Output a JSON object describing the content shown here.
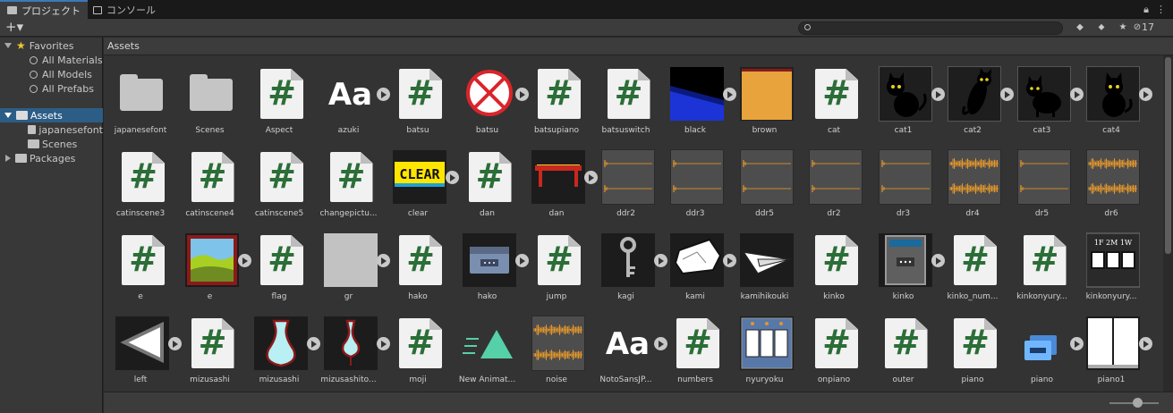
{
  "tabs": [
    {
      "label": "プロジェクト",
      "icon": "folder-icon",
      "active": true
    },
    {
      "label": "コンソール",
      "icon": "console-icon",
      "active": false
    }
  ],
  "toolbar": {
    "add_label": "+▾",
    "search_placeholder": "",
    "hidden_count": "17"
  },
  "sidebar": {
    "favorites_label": "Favorites",
    "favorites": [
      "All Materials",
      "All Models",
      "All Prefabs"
    ],
    "assets_label": "Assets",
    "assets_children": [
      "japanesefont",
      "Scenes"
    ],
    "packages_label": "Packages"
  },
  "breadcrumb": "Assets",
  "assets": [
    {
      "name": "japanesefont",
      "kind": "folder"
    },
    {
      "name": "Scenes",
      "kind": "folder"
    },
    {
      "name": "Aspect",
      "kind": "script"
    },
    {
      "name": "azuki",
      "kind": "font",
      "play": true
    },
    {
      "name": "batsu",
      "kind": "script"
    },
    {
      "name": "batsu",
      "kind": "batsu-sprite",
      "play": true
    },
    {
      "name": "batsupiano",
      "kind": "script"
    },
    {
      "name": "batsuswitch",
      "kind": "script"
    },
    {
      "name": "black",
      "kind": "black-sprite",
      "play": true
    },
    {
      "name": "brown",
      "kind": "brown-sprite"
    },
    {
      "name": "cat",
      "kind": "script"
    },
    {
      "name": "cat1",
      "kind": "cat",
      "play": true
    },
    {
      "name": "cat2",
      "kind": "cat",
      "play": true
    },
    {
      "name": "cat3",
      "kind": "cat",
      "play": true
    },
    {
      "name": "cat4",
      "kind": "cat",
      "play": true
    },
    {
      "name": "catinscene3",
      "kind": "script"
    },
    {
      "name": "catinscene4",
      "kind": "script"
    },
    {
      "name": "catinscene5",
      "kind": "script"
    },
    {
      "name": "changepictu...",
      "kind": "script"
    },
    {
      "name": "clear",
      "kind": "clear-sprite",
      "play": true
    },
    {
      "name": "dan",
      "kind": "script"
    },
    {
      "name": "dan",
      "kind": "dan-sprite",
      "play": true
    },
    {
      "name": "ddr2",
      "kind": "audio-thin"
    },
    {
      "name": "ddr3",
      "kind": "audio-thin"
    },
    {
      "name": "ddr5",
      "kind": "audio-thin"
    },
    {
      "name": "dr2",
      "kind": "audio-thin"
    },
    {
      "name": "dr3",
      "kind": "audio-thin"
    },
    {
      "name": "dr4",
      "kind": "audio-thick"
    },
    {
      "name": "dr5",
      "kind": "audio-thin"
    },
    {
      "name": "dr6",
      "kind": "audio-thick"
    },
    {
      "name": "e",
      "kind": "script"
    },
    {
      "name": "e",
      "kind": "picture-sprite",
      "play": true
    },
    {
      "name": "flag",
      "kind": "script"
    },
    {
      "name": "gr",
      "kind": "gray-sprite",
      "play": true
    },
    {
      "name": "hako",
      "kind": "script"
    },
    {
      "name": "hako",
      "kind": "hako-sprite",
      "play": true
    },
    {
      "name": "jump",
      "kind": "script"
    },
    {
      "name": "kagi",
      "kind": "key-sprite",
      "play": true
    },
    {
      "name": "kami",
      "kind": "paper-sprite",
      "play": true
    },
    {
      "name": "kamihikouki",
      "kind": "plane-sprite"
    },
    {
      "name": "kinko",
      "kind": "script"
    },
    {
      "name": "kinko",
      "kind": "safe-sprite",
      "play": true
    },
    {
      "name": "kinko_num...",
      "kind": "script"
    },
    {
      "name": "kinkonyury...",
      "kind": "script"
    },
    {
      "name": "kinkonyury...",
      "kind": "boxes-sprite"
    },
    {
      "name": "left",
      "kind": "left-sprite",
      "play": true
    },
    {
      "name": "mizusashi",
      "kind": "script"
    },
    {
      "name": "mizusashi",
      "kind": "vase-sprite",
      "play": true
    },
    {
      "name": "mizusashito...",
      "kind": "vase-thin-sprite",
      "play": true
    },
    {
      "name": "moji",
      "kind": "script"
    },
    {
      "name": "New Animat...",
      "kind": "anim"
    },
    {
      "name": "noise",
      "kind": "audio-thick"
    },
    {
      "name": "NotoSansJP...",
      "kind": "font",
      "play": true
    },
    {
      "name": "numbers",
      "kind": "script"
    },
    {
      "name": "nyuryoku",
      "kind": "nyuryoku-sprite"
    },
    {
      "name": "onpiano",
      "kind": "script"
    },
    {
      "name": "outer",
      "kind": "script"
    },
    {
      "name": "piano",
      "kind": "script"
    },
    {
      "name": "piano",
      "kind": "prefab",
      "play": true
    },
    {
      "name": "piano1",
      "kind": "piano-sprite",
      "play": true
    }
  ],
  "thumb_text": {
    "clear": "CLEAR",
    "boxes": "1F 2M 1W"
  }
}
